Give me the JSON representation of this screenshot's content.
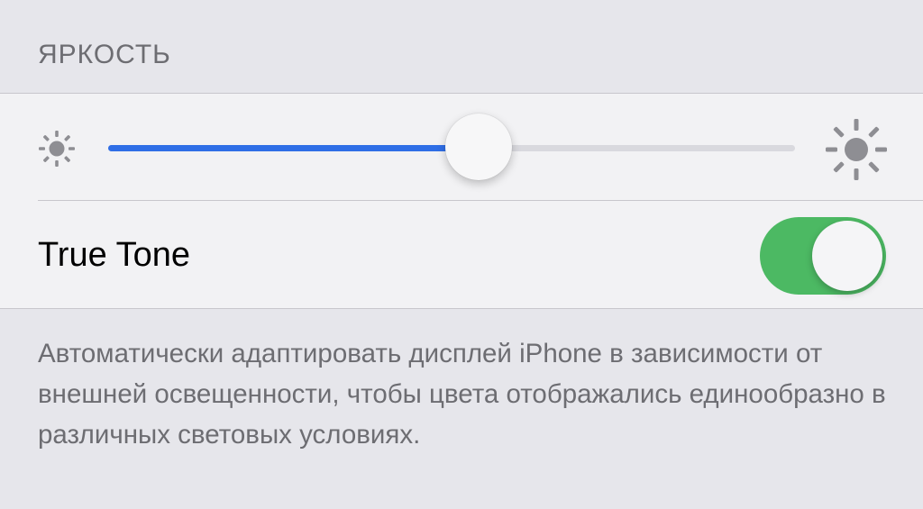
{
  "brightness": {
    "header": "ЯРКОСТЬ",
    "level": 0.54,
    "low_icon": "sun-min-icon",
    "high_icon": "sun-max-icon",
    "fill_color": "#2f6ee6"
  },
  "true_tone": {
    "label": "True Tone",
    "enabled": true,
    "toggle_color": "#4cb963",
    "description": "Автоматически адаптировать дисплей iPhone в зависимости от внешней освещенности, чтобы цвета отображались единообразно в различных световых условиях."
  }
}
